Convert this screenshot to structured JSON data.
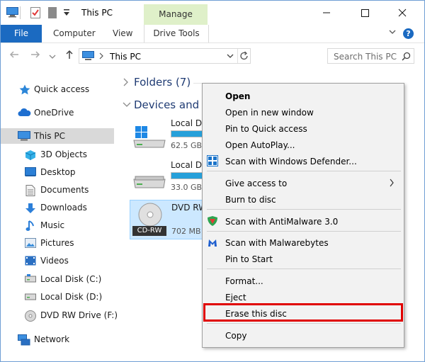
{
  "titlebar": {
    "title": "This PC",
    "contextual_tab": "Manage"
  },
  "ribbon": {
    "tabs": [
      "File",
      "Computer",
      "View",
      "Drive Tools"
    ]
  },
  "address": {
    "path": "This PC"
  },
  "search": {
    "placeholder": "Search This PC"
  },
  "navpane": {
    "items": [
      {
        "label": "Quick access",
        "icon": "star-icon"
      },
      {
        "label": "OneDrive",
        "icon": "cloud-icon"
      },
      {
        "label": "This PC",
        "icon": "computer-icon",
        "selected": true
      },
      {
        "label": "3D Objects",
        "icon": "cube-icon"
      },
      {
        "label": "Desktop",
        "icon": "desktop-icon"
      },
      {
        "label": "Documents",
        "icon": "document-icon"
      },
      {
        "label": "Downloads",
        "icon": "download-icon"
      },
      {
        "label": "Music",
        "icon": "music-icon"
      },
      {
        "label": "Pictures",
        "icon": "picture-icon"
      },
      {
        "label": "Videos",
        "icon": "video-icon"
      },
      {
        "label": "Local Disk (C:)",
        "icon": "drive-icon"
      },
      {
        "label": "Local Disk (D:)",
        "icon": "drive-icon"
      },
      {
        "label": "DVD RW Drive (F:)",
        "icon": "disc-icon"
      },
      {
        "label": "Network",
        "icon": "network-icon"
      }
    ]
  },
  "content": {
    "folders_group": "Folders (7)",
    "devices_group": "Devices and d",
    "drives": [
      {
        "name": "Local D",
        "size": "62.5 GB",
        "used_fraction": 0.85
      },
      {
        "name": "Local D",
        "size": "33.0 GB",
        "used_fraction": 0.85
      },
      {
        "name": "DVD RW",
        "size": "702 MB",
        "badge": "CD-RW"
      }
    ]
  },
  "context_menu": {
    "items": [
      {
        "label": "Open",
        "bold": true
      },
      {
        "label": "Open in new window"
      },
      {
        "label": "Pin to Quick access"
      },
      {
        "label": "Open AutoPlay..."
      },
      {
        "label": "Scan with Windows Defender...",
        "icon": "defender-icon"
      },
      {
        "label": "Give access to",
        "submenu": true
      },
      {
        "label": "Burn to disc"
      },
      {
        "label": "Scan with AntiMalware 3.0",
        "icon": "antimalware-icon"
      },
      {
        "label": "Scan with Malwarebytes",
        "icon": "malwarebytes-icon"
      },
      {
        "label": "Pin to Start"
      },
      {
        "label": "Format..."
      },
      {
        "label": "Eject"
      },
      {
        "label": "Erase this disc",
        "highlighted": true
      },
      {
        "label": "Copy"
      }
    ]
  },
  "colors": {
    "accent": "#1b6ac1",
    "manage_tab": "#dff0c9",
    "highlight": "#e00000",
    "selection": "#cce8ff"
  }
}
